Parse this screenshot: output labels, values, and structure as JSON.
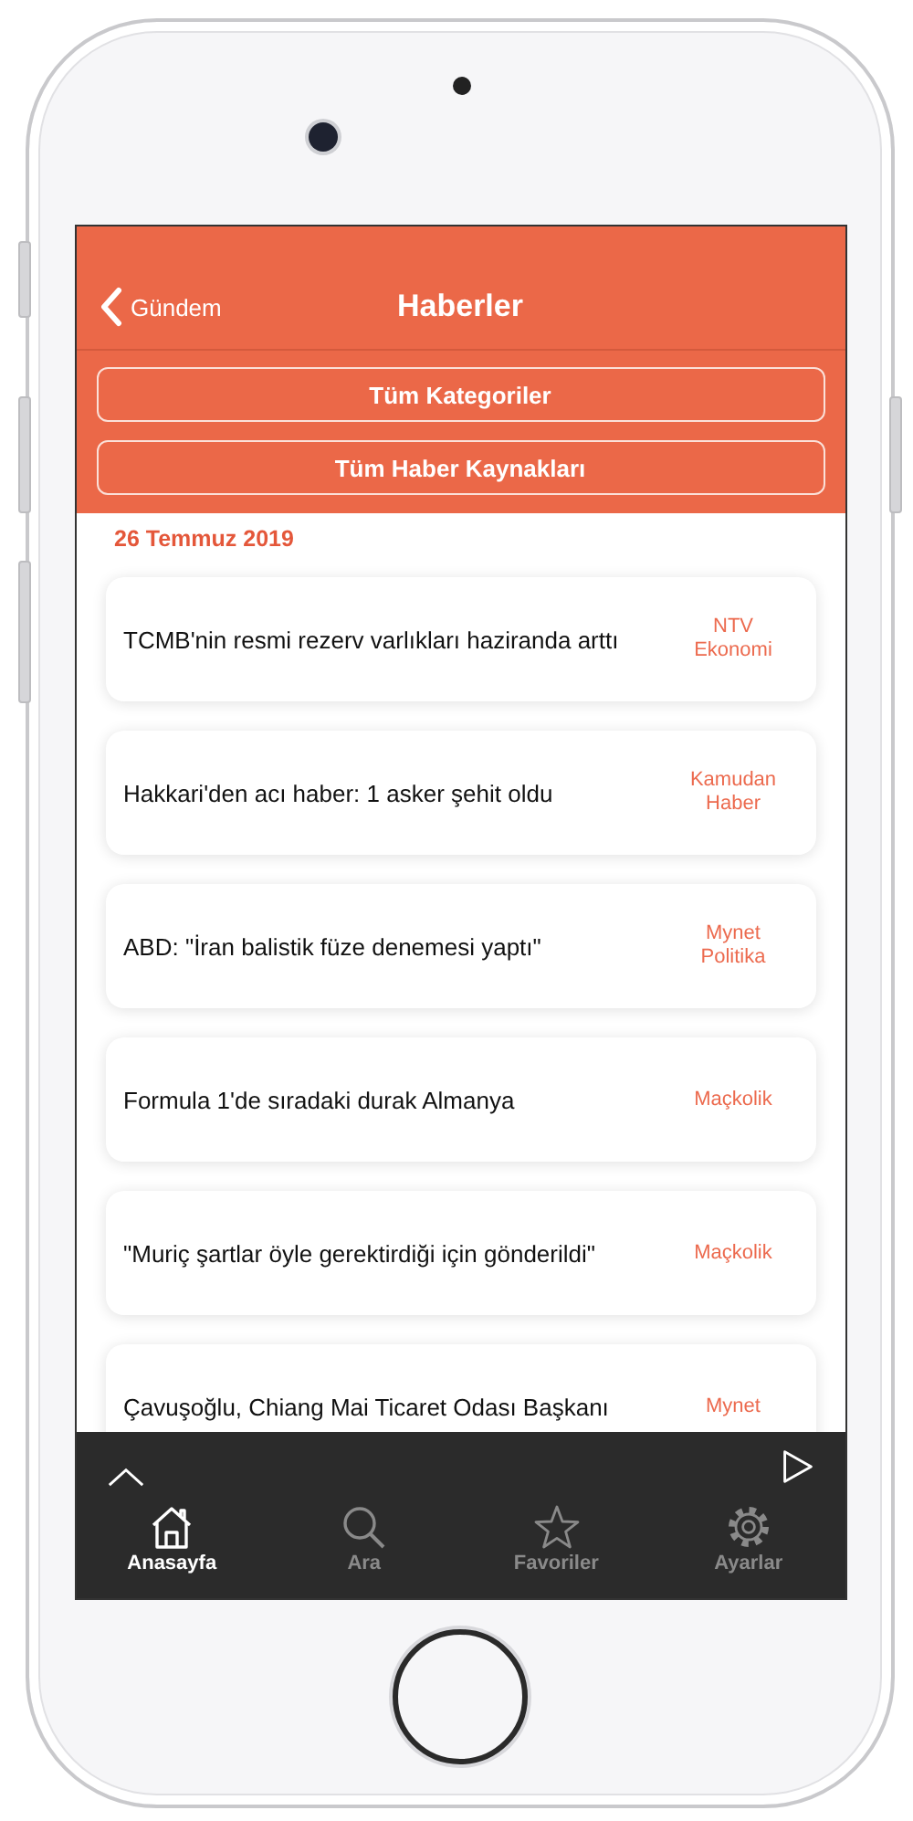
{
  "nav": {
    "back": "Gündem",
    "title": "Haberler"
  },
  "filters": [
    "Tüm Kategoriler",
    "Tüm Haber Kaynakları"
  ],
  "date": "26 Temmuz 2019",
  "news": [
    {
      "title": "TCMB'nin resmi rezerv varlıkları haziranda arttı",
      "source": "NTV Ekonomi"
    },
    {
      "title": "Hakkari'den acı haber: 1 asker şehit oldu",
      "source": "Kamudan Haber"
    },
    {
      "title": "ABD: \"İran balistik füze denemesi yaptı\"",
      "source": "Mynet Politika"
    },
    {
      "title": "Formula 1'de sıradaki durak Almanya",
      "source": "Maçkolik"
    },
    {
      "title": "\"Muriç şartlar öyle gerektirdiği için gönderildi\"",
      "source": "Maçkolik"
    },
    {
      "title": "Çavuşoğlu, Chiang Mai Ticaret Odası Başkanı",
      "source": "Mynet"
    }
  ],
  "tabs": [
    {
      "kind": "home",
      "label": "Anasayfa",
      "selected": true
    },
    {
      "kind": "search",
      "label": "Ara",
      "selected": false
    },
    {
      "kind": "star",
      "label": "Favoriler",
      "selected": false
    },
    {
      "kind": "gear",
      "label": "Ayarlar",
      "selected": false
    }
  ]
}
